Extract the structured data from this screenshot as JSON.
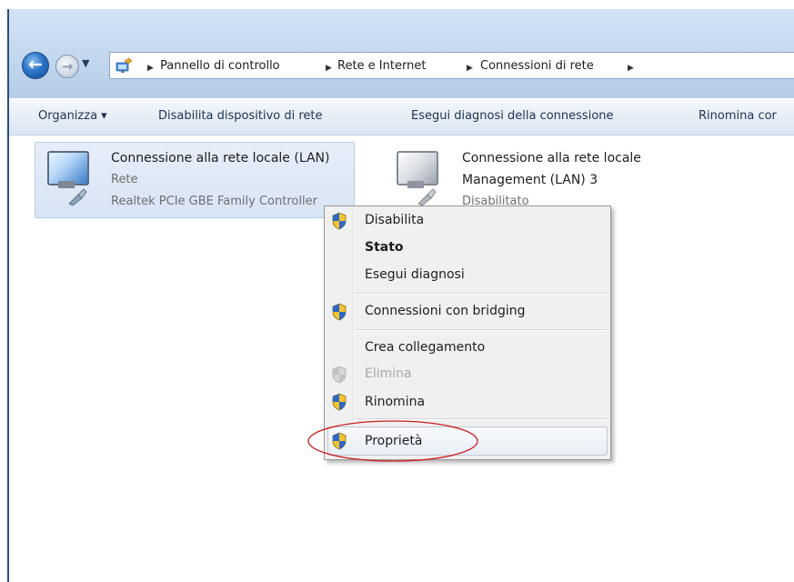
{
  "breadcrumb": {
    "items": [
      "Pannello di controllo",
      "Rete e Internet",
      "Connessioni di rete"
    ]
  },
  "toolbar": {
    "organize": "Organizza ▾",
    "disable_device": "Disabilita dispositivo di rete",
    "diagnose": "Esegui diagnosi della connessione",
    "rename": "Rinomina cor"
  },
  "connections": [
    {
      "name": "Connessione alla rete locale (LAN)",
      "network": "Rete",
      "adapter": "Realtek PCIe GBE Family Controller"
    },
    {
      "name": "Connessione alla rete locale",
      "name_line2": "Management (LAN) 3",
      "status": "Disabilitato"
    }
  ],
  "context_menu": {
    "items": [
      {
        "label": "Disabilita",
        "icon": "uac-shield-icon"
      },
      {
        "label": "Stato",
        "bold": true
      },
      {
        "label": "Esegui diagnosi"
      },
      {
        "label": "Connessioni con bridging",
        "icon": "uac-shield-icon"
      },
      {
        "label": "Crea collegamento"
      },
      {
        "label": "Elimina",
        "icon": "uac-shield-icon",
        "disabled": true
      },
      {
        "label": "Rinomina",
        "icon": "uac-shield-icon"
      },
      {
        "label": "Proprietà",
        "icon": "uac-shield-icon",
        "highlighted": true
      }
    ]
  },
  "colors": {
    "window_chrome": "#c3d7ee",
    "selection": "#d8e5f5",
    "annotation": "#cc2020",
    "menu_background": "#f0f0f0"
  }
}
